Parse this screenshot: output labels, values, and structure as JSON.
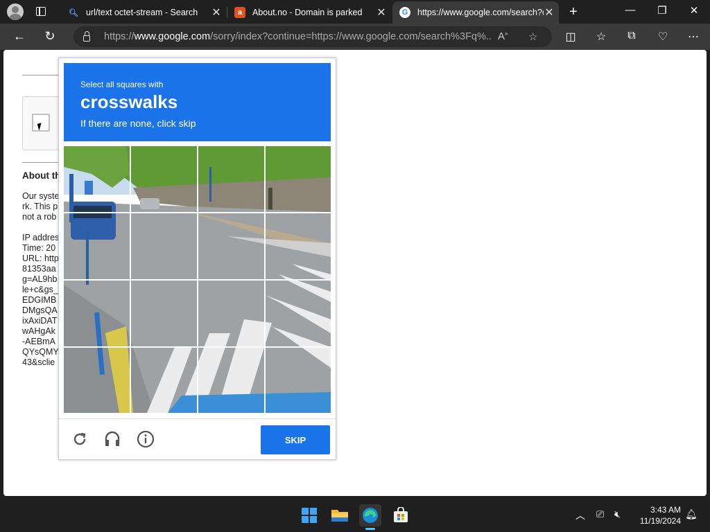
{
  "browser": {
    "tabs": [
      {
        "title": "url/text octet-stream - Search",
        "favicon": "bing-search-icon",
        "active": false
      },
      {
        "title": "About.no - Domain is parked",
        "favicon": "about-no-icon",
        "active": false
      },
      {
        "title": "https://www.google.com/search?q=",
        "favicon": "google-icon",
        "active": true
      }
    ],
    "address": {
      "prefix": "https://",
      "domain": "www.google.com",
      "rest": "/sorry/index?continue=https://www.google.com/search%3Fq%..."
    }
  },
  "page": {
    "about_heading": "About th",
    "text_lines": [
      "Our syste",
      "rk. This p",
      "not a rob",
      "",
      "IP addres",
      "Time: 20",
      "URL: http",
      "81353aa",
      "g=AL9hb",
      "le+c&gs_",
      "EDGIMB",
      "DMgsQA",
      "ixAxiDAT",
      "wAHgAk",
      "-AEBmA",
      "QYsQMY",
      "43&sclie"
    ]
  },
  "captcha": {
    "instruction_small": "Select all squares with",
    "target": "crosswalks",
    "note": "If there are none, click skip",
    "skip_label": "SKIP",
    "grid_size": 4,
    "colors": {
      "header": "#1a73e8",
      "button": "#1a73e8"
    }
  },
  "taskbar": {
    "apps": [
      "windows-start-icon",
      "file-explorer-icon",
      "edge-icon",
      "store-icon"
    ],
    "time": "3:43 AM",
    "date": "11/19/2024"
  }
}
